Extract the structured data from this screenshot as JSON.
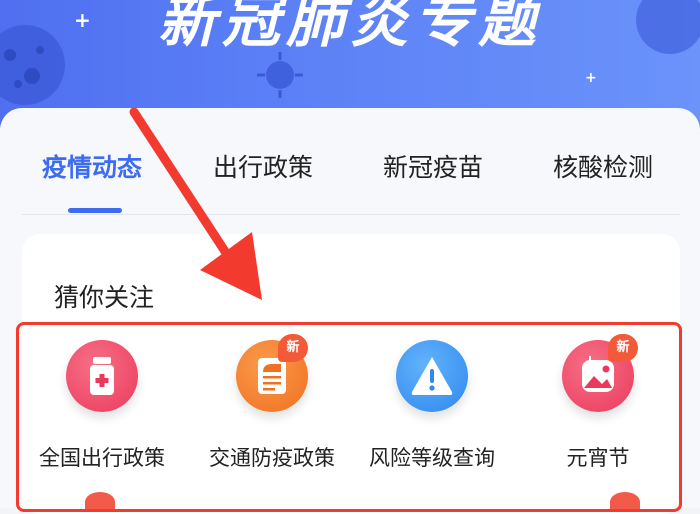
{
  "banner": {
    "title": "新冠肺炎专题"
  },
  "tabs": [
    {
      "label": "疫情动态",
      "active": true
    },
    {
      "label": "出行政策",
      "active": false
    },
    {
      "label": "新冠疫苗",
      "active": false
    },
    {
      "label": "核酸检测",
      "active": false
    }
  ],
  "section": {
    "title": "猜你关注"
  },
  "services": [
    {
      "label": "全国出行政策",
      "icon": "medicine-bottle-icon",
      "color": "#f04b6a",
      "badge": ""
    },
    {
      "label": "交通防疫政策",
      "icon": "train-ticket-icon",
      "color": "#f47a2e",
      "badge": "新"
    },
    {
      "label": "风险等级查询",
      "icon": "warning-triangle-icon",
      "color": "#3f9bf5",
      "badge": ""
    },
    {
      "label": "元宵节",
      "icon": "lantern-picture-icon",
      "color": "#f04b6a",
      "badge": "新"
    }
  ],
  "colors": {
    "accent": "#3d6cf0",
    "annotation": "#f23a2f",
    "badge": "#f35a3a"
  }
}
